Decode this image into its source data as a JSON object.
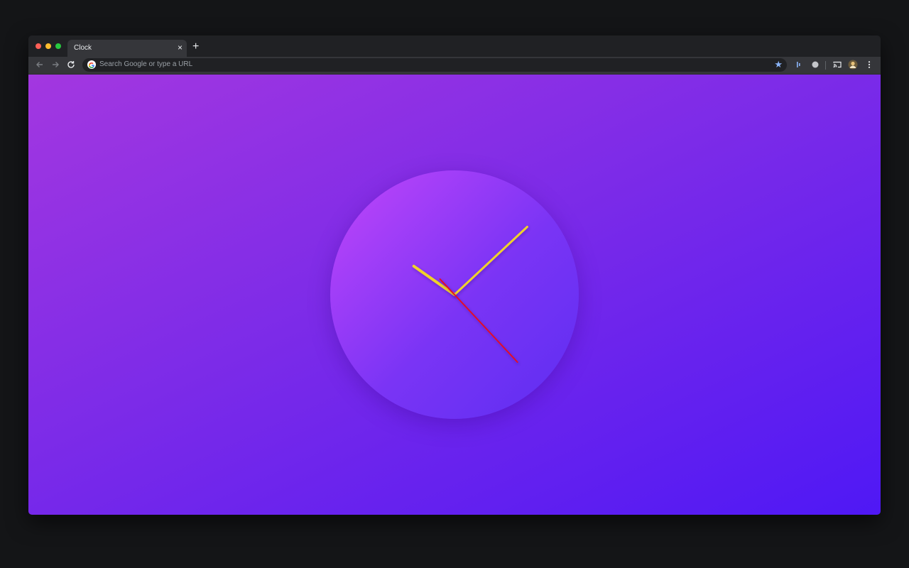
{
  "browser": {
    "tab": {
      "title": "Clock",
      "close_glyph": "×"
    },
    "new_tab_glyph": "+",
    "toolbar": {
      "back_icon": "arrow-left-icon",
      "forward_icon": "arrow-right-icon",
      "reload_icon": "reload-icon",
      "omnibox_placeholder": "Search Google or type a URL",
      "bookmark_icon": "star-icon",
      "extensions": [
        "extension-bars-icon",
        "extension-circle-icon",
        "cast-icon",
        "profile-avatar",
        "menu-icon"
      ]
    }
  },
  "page": {
    "background_colors": [
      "#a337e0",
      "#4f18f5"
    ],
    "clock": {
      "face_colors": [
        "#c246fa",
        "#5d2ef2"
      ],
      "hour_hand_color": "#f0d22a",
      "minute_hand_color": "#f0d22a",
      "second_hand_color": "#e0102a",
      "time": {
        "hours": 9,
        "minutes": 10,
        "seconds": 23
      }
    }
  },
  "colors": {
    "window_background": "#141517",
    "titlebar": "#202124",
    "tab_active": "#35363a",
    "accent_star": "#8ab4f8",
    "traffic_close": "#ff5f57",
    "traffic_minimize": "#febc2e",
    "traffic_zoom": "#28c840"
  }
}
